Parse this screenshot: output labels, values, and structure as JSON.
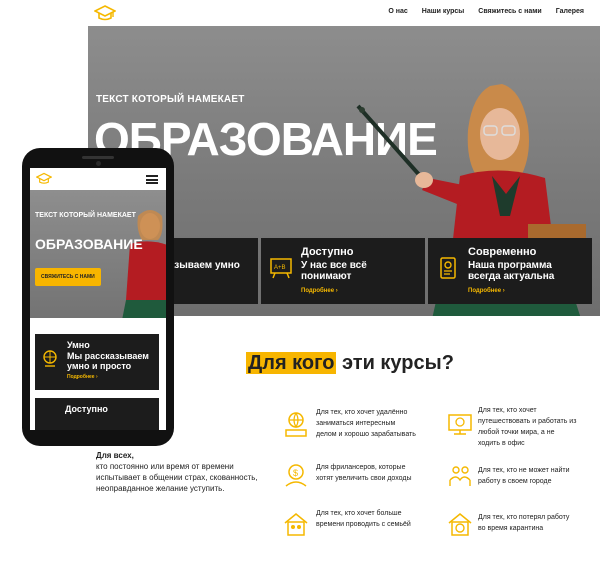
{
  "nav": [
    "О нас",
    "Наши курсы",
    "Свяжитесь с нами",
    "Галерея"
  ],
  "hero": {
    "subtitle": "ТЕКСТ КОТОРЫЙ НАМЕКАЕТ",
    "title": "ОБРАЗОВАНИЕ"
  },
  "features": [
    {
      "title": "",
      "desc": "сказываем умно",
      "desc2": "о",
      "more": ""
    },
    {
      "title": "Доступно",
      "desc": "У нас все всё",
      "desc2": "понимают",
      "more": "Подробнее"
    },
    {
      "title": "Современно",
      "desc": "Наша программа",
      "desc2": "всегда актуальна",
      "more": "Подробнее"
    }
  ],
  "section": {
    "highlight": "Для кого",
    "rest": " эти курсы?"
  },
  "forall": {
    "title": "Для всех,",
    "text": "кто постоянно или время от времени испытывает в общении страх, скованность, неоправданное желание уступить."
  },
  "audience": [
    {
      "text": "Для тех, кто хочет удалённо заниматься интересным делом и хорошо зарабатывать",
      "icon": "remote-work-icon"
    },
    {
      "text": "Для тех, кто хочет путешествовать и работать из любой точки мира, а не ходить в офис",
      "icon": "travel-icon"
    },
    {
      "text": "Для фрилансеров, которые хотят увеличить свои доходы",
      "icon": "freelancer-icon"
    },
    {
      "text": "Для тех, кто не может найти работу в своем городе",
      "icon": "job-search-icon"
    },
    {
      "text": "Для тех, кто хочет больше времени проводить с семьёй",
      "icon": "family-icon"
    },
    {
      "text": "Для тех, кто потерял работу во время карантина",
      "icon": "quarantine-icon"
    }
  ],
  "mobile": {
    "subtitle": "ТЕКСТ КОТОРЫЙ НАМЕКАЕТ",
    "title": "ОБРАЗОВАНИЕ",
    "button": "СВЯЖИТЕСЬ С НАМИ",
    "card1": {
      "title": "Умно",
      "desc": "Мы рассказываем",
      "desc2": "умно и просто",
      "more": "Подробнее"
    },
    "card2": {
      "title": "Доступно"
    }
  },
  "colors": {
    "accent": "#f7b500",
    "dark": "#1c1c1c"
  }
}
